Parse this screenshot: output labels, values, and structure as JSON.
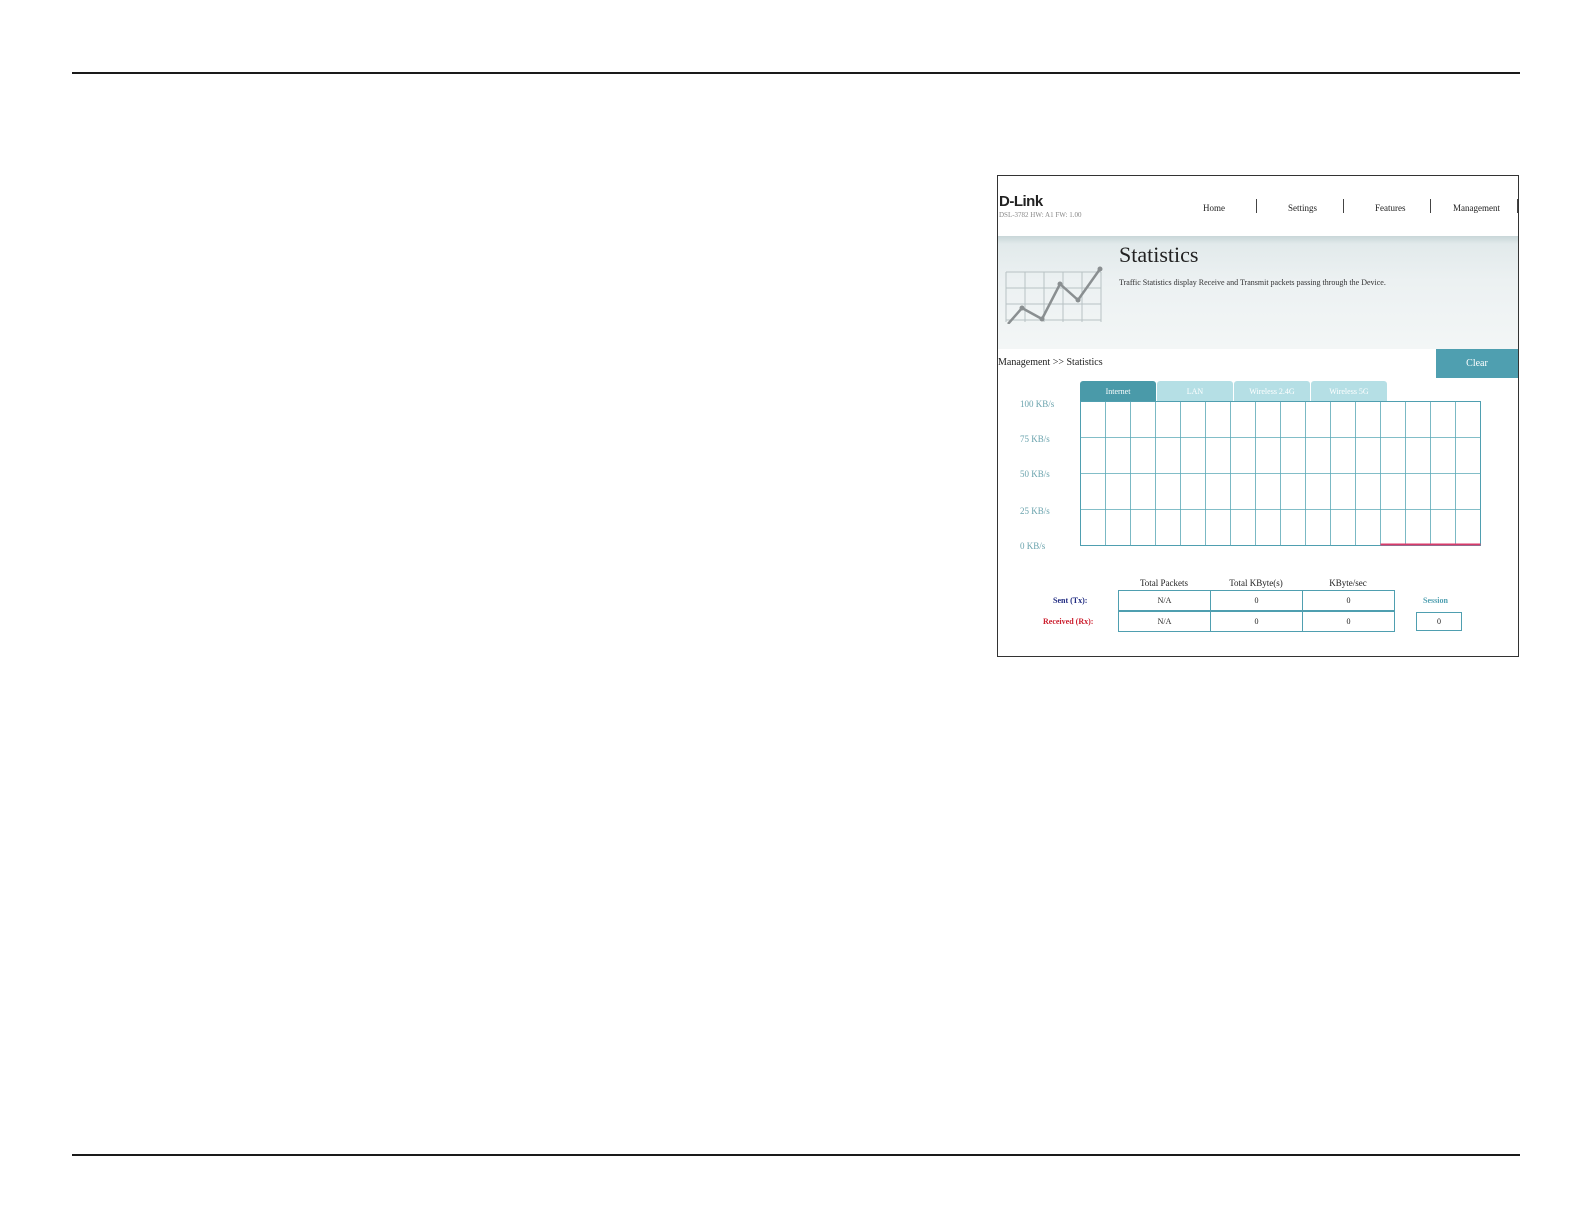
{
  "router": {
    "brand": "D-Link",
    "model_info": "DSL-3782  HW: A1  FW: 1.00",
    "nav": [
      "Home",
      "Settings",
      "Features",
      "Management"
    ],
    "page_title": "Statistics",
    "page_description": "Traffic Statistics display Receive and Transmit packets passing through the Device.",
    "breadcrumb": "Management >> Statistics",
    "clear_label": "Clear",
    "tabs": [
      "Internet",
      "LAN",
      "Wireless 2.4G",
      "Wireless 5G"
    ],
    "active_tab": "Internet"
  },
  "stats": {
    "headers": [
      "Total Packets",
      "Total KByte(s)",
      "KByte/sec"
    ],
    "sent_label": "Sent (Tx):",
    "received_label": "Received (Rx):",
    "sent_values": [
      "N/A",
      "0",
      "0"
    ],
    "received_values": [
      "N/A",
      "0",
      "0"
    ],
    "session_label": "Session",
    "session_value": "0"
  },
  "colors": {
    "accent": "#4f9fb0",
    "tab_active": "#4a9aa9",
    "tab_inactive": "#b5dfe5",
    "sent": "#1f2a80",
    "received": "#cc1f2f",
    "rx_line": "#d83a6a"
  },
  "chart_data": {
    "type": "line",
    "y_tick_labels": [
      "100 KB/s",
      "75 KB/s",
      "50 KB/s",
      "25 KB/s",
      "0 KB/s"
    ],
    "ylim": [
      0,
      100
    ],
    "grid": true,
    "series": [
      {
        "values": [
          0,
          0,
          0,
          0
        ]
      }
    ]
  }
}
